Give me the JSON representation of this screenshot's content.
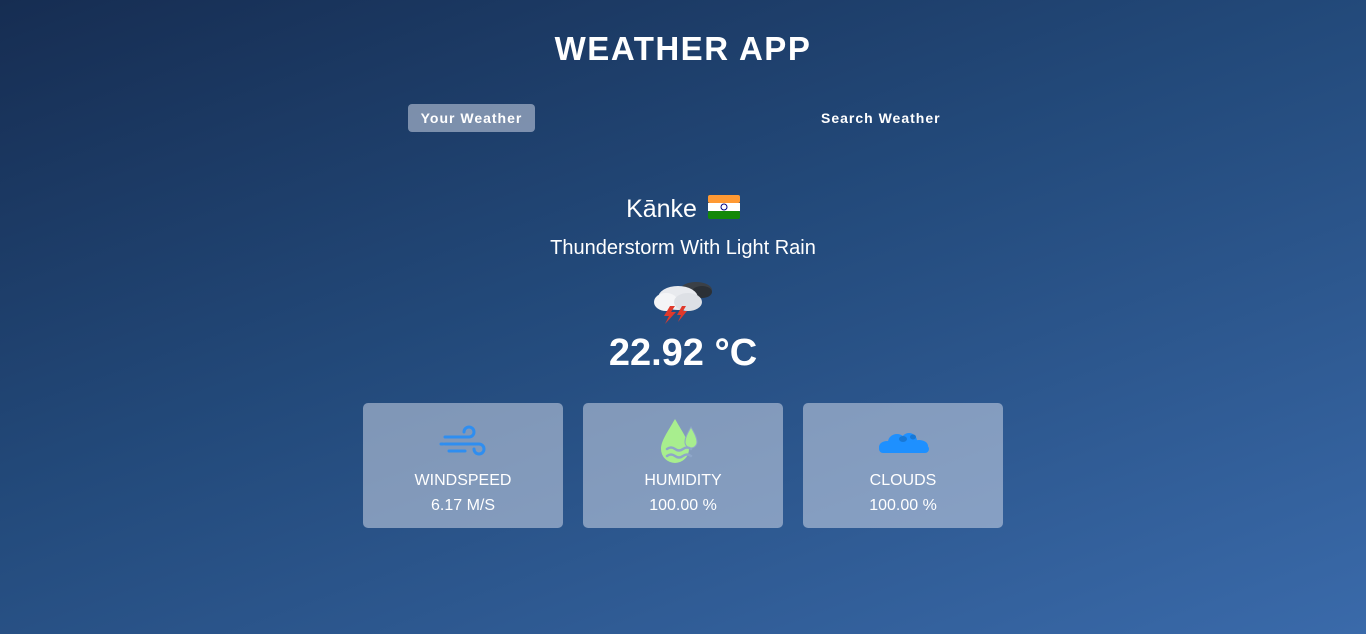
{
  "app": {
    "title": "WEATHER APP"
  },
  "tabs": [
    {
      "label": "Your Weather",
      "active": true
    },
    {
      "label": "Search Weather",
      "active": false
    }
  ],
  "location": {
    "city": "Kānke",
    "country_flag_icon": "india-flag-icon"
  },
  "weather": {
    "description": "Thunderstorm With Light Rain",
    "icon": "thunderstorm-icon",
    "temperature": "22.92 °C"
  },
  "stats": [
    {
      "label": "WINDSPEED",
      "value": "6.17 M/S",
      "icon": "wind-icon",
      "color": "#2f8ef0"
    },
    {
      "label": "HUMIDITY",
      "value": "100.00 %",
      "icon": "humidity-icon",
      "color": "#a8ee8e"
    },
    {
      "label": "CLOUDS",
      "value": "100.00 %",
      "icon": "clouds-icon",
      "color": "#1e90ff"
    }
  ]
}
